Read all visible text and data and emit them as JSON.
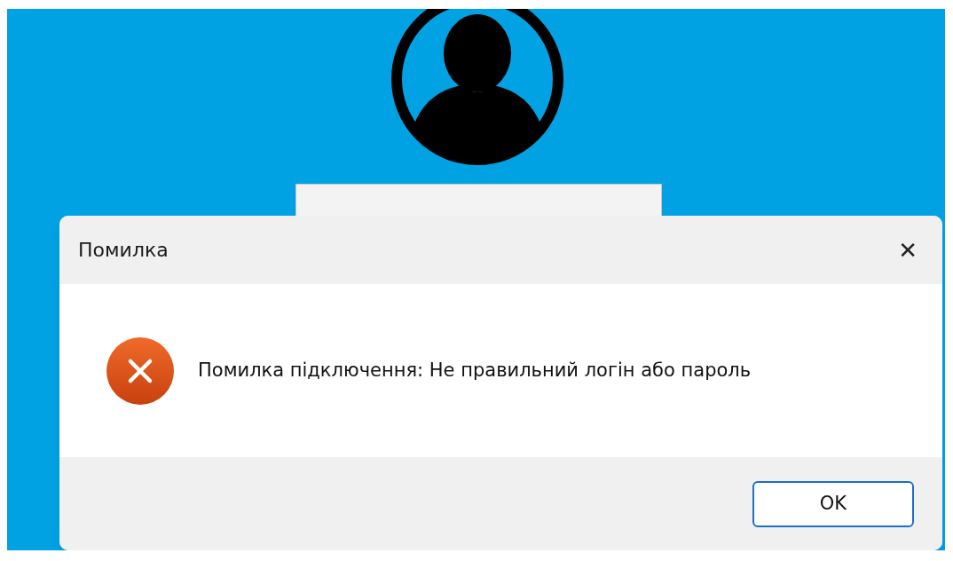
{
  "dialog": {
    "title": "Помилка",
    "close": "✕",
    "message": "Помилка підключення: Не правильний логін або пароль",
    "buttons": [
      "OK"
    ]
  }
}
